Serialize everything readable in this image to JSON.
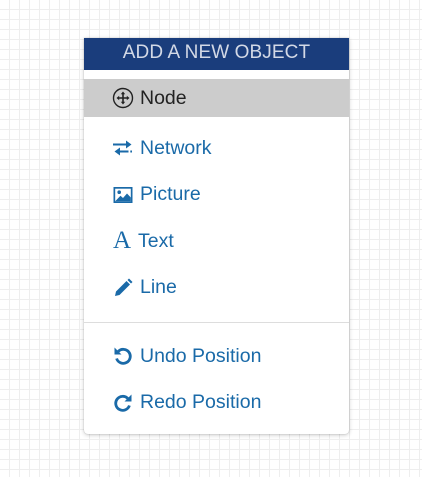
{
  "menu": {
    "header": "ADD A NEW OBJECT",
    "items": [
      {
        "label": "Node",
        "icon": "move-arrows-icon"
      },
      {
        "label": "Network",
        "icon": "exchange-arrows-icon"
      },
      {
        "label": "Picture",
        "icon": "picture-icon"
      },
      {
        "label": "Text",
        "icon": "text-letter-icon",
        "glyph": "A"
      },
      {
        "label": "Line",
        "icon": "pencil-icon"
      }
    ],
    "history": [
      {
        "label": "Undo Position",
        "icon": "undo-icon"
      },
      {
        "label": "Redo Position",
        "icon": "redo-icon"
      }
    ]
  },
  "colors": {
    "header_bg": "#1a3d7c",
    "header_text": "#d3d9e6",
    "link": "#1a6aa8",
    "active_bg": "#cccccc",
    "grid_line": "#eeeeee"
  }
}
